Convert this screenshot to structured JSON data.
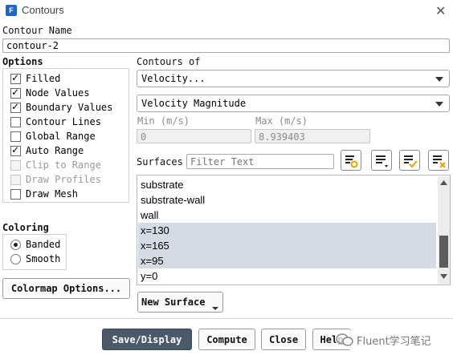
{
  "window": {
    "title": "Contours",
    "app_icon_letter": "F"
  },
  "contour_name": {
    "label": "Contour Name",
    "value": "contour-2"
  },
  "options": {
    "label": "Options",
    "items": [
      {
        "label": "Filled",
        "checked": true,
        "enabled": true
      },
      {
        "label": "Node Values",
        "checked": true,
        "enabled": true
      },
      {
        "label": "Boundary Values",
        "checked": true,
        "enabled": true
      },
      {
        "label": "Contour Lines",
        "checked": false,
        "enabled": true
      },
      {
        "label": "Global Range",
        "checked": false,
        "enabled": true
      },
      {
        "label": "Auto Range",
        "checked": true,
        "enabled": true
      },
      {
        "label": "Clip to Range",
        "checked": false,
        "enabled": false
      },
      {
        "label": "Draw Profiles",
        "checked": false,
        "enabled": false
      },
      {
        "label": "Draw Mesh",
        "checked": false,
        "enabled": true
      }
    ]
  },
  "contours_of": {
    "label": "Contours of",
    "category": "Velocity...",
    "variable": "Velocity Magnitude"
  },
  "range": {
    "min_label": "Min (m/s)",
    "min_value": "0",
    "max_label": "Max (m/s)",
    "max_value": "8.939403"
  },
  "surfaces": {
    "label": "Surfaces",
    "filter_placeholder": "Filter Text",
    "items": [
      {
        "label": "substrate",
        "selected": false
      },
      {
        "label": "substrate-wall",
        "selected": false
      },
      {
        "label": "wall",
        "selected": false
      },
      {
        "label": "x=130",
        "selected": true
      },
      {
        "label": "x=165",
        "selected": true
      },
      {
        "label": "x=95",
        "selected": true
      },
      {
        "label": "y=0",
        "selected": false
      }
    ],
    "scroll_position_fraction": 0.6
  },
  "coloring": {
    "label": "Coloring",
    "options": [
      {
        "label": "Banded",
        "selected": true
      },
      {
        "label": "Smooth",
        "selected": false
      }
    ]
  },
  "buttons": {
    "colormap": "Colormap Options...",
    "new_surface": "New Surface",
    "save_display": "Save/Display",
    "compute": "Compute",
    "close": "Close",
    "help": "Help"
  },
  "watermark": "Fluent学习笔记",
  "colors": {
    "primary_button": "#4a5a6b",
    "selection": "#d5dbe5",
    "scroll_thumb": "#5b5b5b"
  }
}
